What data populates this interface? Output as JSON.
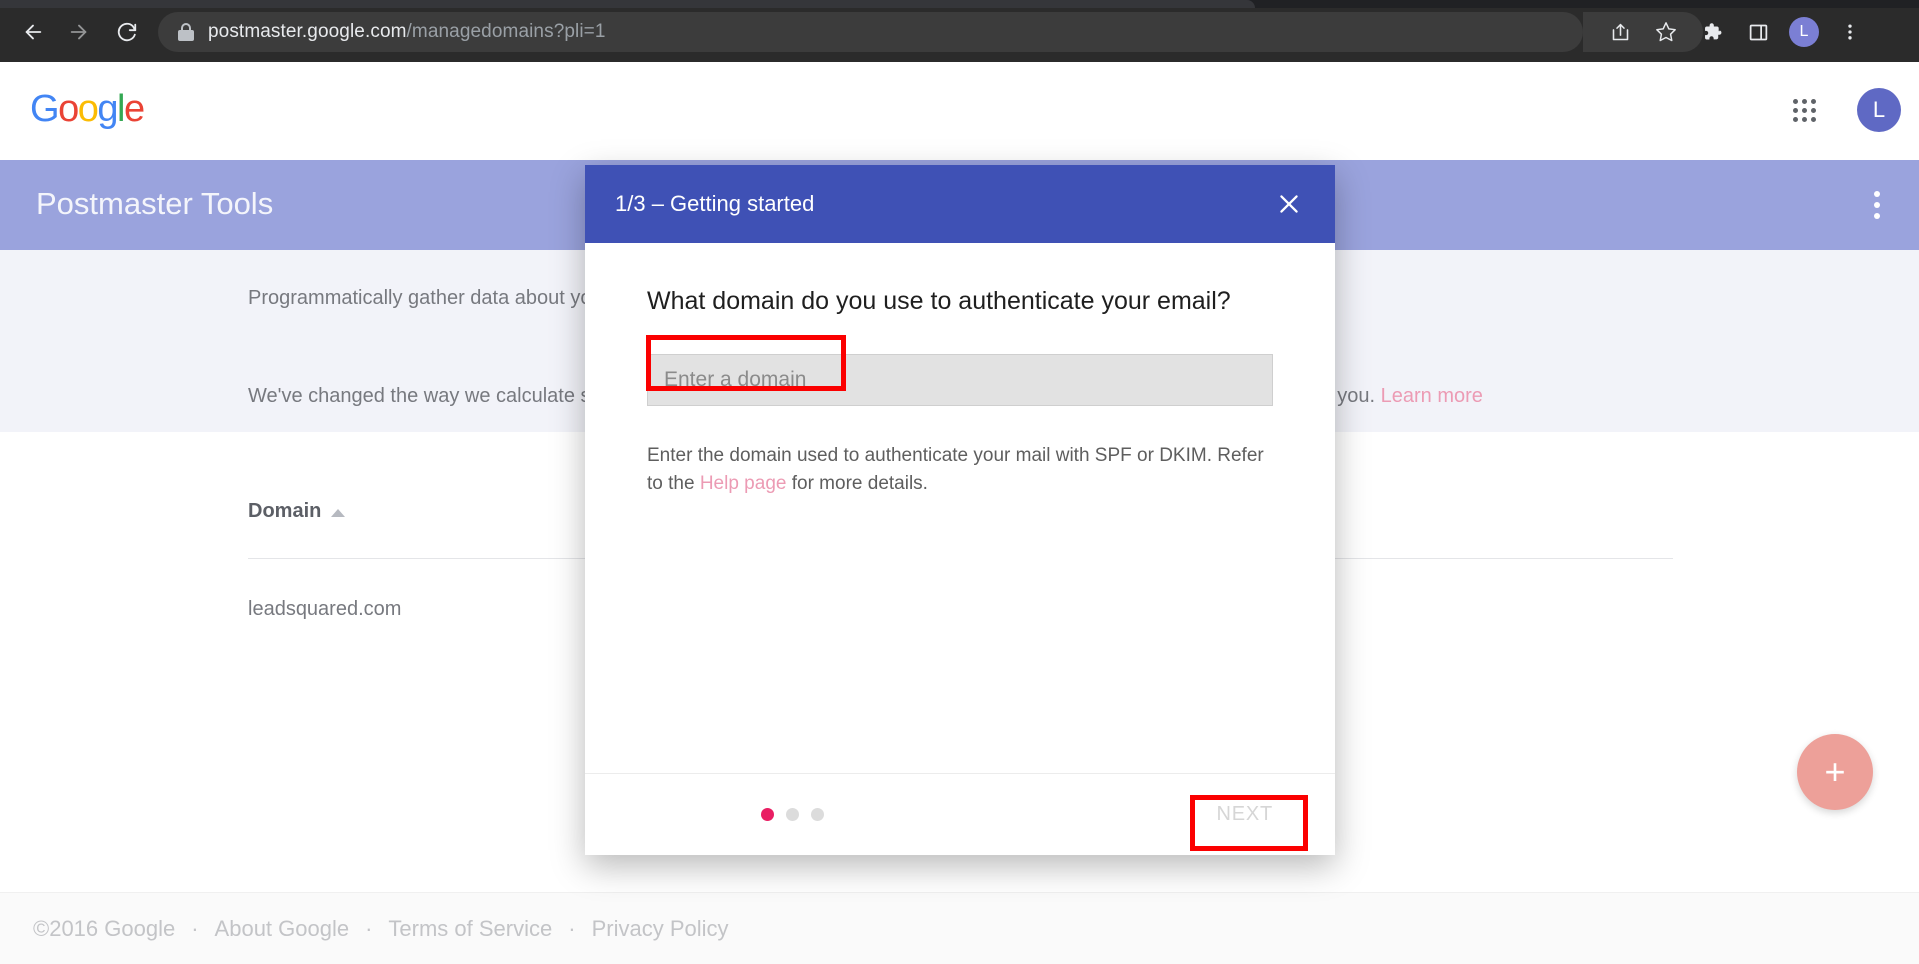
{
  "browser": {
    "url_host": "postmaster.google.com",
    "url_path": "/managedomains?pli=1",
    "back_icon": "back-arrow-icon",
    "forward_icon": "forward-arrow-icon",
    "reload_icon": "reload-icon",
    "lock_icon": "lock-icon",
    "share_icon": "share-icon",
    "bookmark_icon": "bookmark-star-icon",
    "extensions_icon": "extensions-puzzle-icon",
    "side_panel_icon": "side-panel-icon",
    "profile_initial": "L",
    "menu_icon": "three-dot-menu-icon"
  },
  "google_header": {
    "logo_letters": [
      "G",
      "o",
      "o",
      "g",
      "l",
      "e"
    ],
    "apps_icon": "google-apps-grid-icon",
    "account_initial": "L"
  },
  "app_bar": {
    "title": "Postmaster Tools",
    "overflow_icon": "three-dot-menu-icon",
    "background_color": "#9aa3dd"
  },
  "notice": {
    "line1": "Programmatically gather data about yo",
    "line2_before": "We've changed the way we calculate sp",
    "line2_after": "e for you.",
    "learn_more_label": "Learn more"
  },
  "table": {
    "column_header": "Domain",
    "sort_icon": "sort-ascending-arrow-icon",
    "rows": [
      {
        "domain": "leadsquared.com"
      }
    ]
  },
  "fab": {
    "label": "+",
    "icon": "plus-icon",
    "color": "#eda099"
  },
  "footer": {
    "copyright": "©2016 Google",
    "separator": "·",
    "links": [
      "About Google",
      "Terms of Service",
      "Privacy Policy"
    ]
  },
  "modal": {
    "step_title": "1/3 – Getting started",
    "close_icon": "close-x-icon",
    "question": "What domain do you use to authenticate your email?",
    "input_placeholder": "Enter a domain",
    "input_value": "",
    "help_text_before": "Enter the domain used to authenticate your mail with SPF or DKIM. Refer to the ",
    "help_link_label": "Help page",
    "help_text_after": " for more details.",
    "pagination_dots": 3,
    "pagination_active_index": 0,
    "next_label": "NEXT",
    "next_disabled": true,
    "header_color": "#3f51b5",
    "accent_color": "#e91e63"
  },
  "annotations": {
    "color": "#fb0000",
    "boxes": [
      "domain-input-highlight",
      "next-button-highlight"
    ]
  }
}
